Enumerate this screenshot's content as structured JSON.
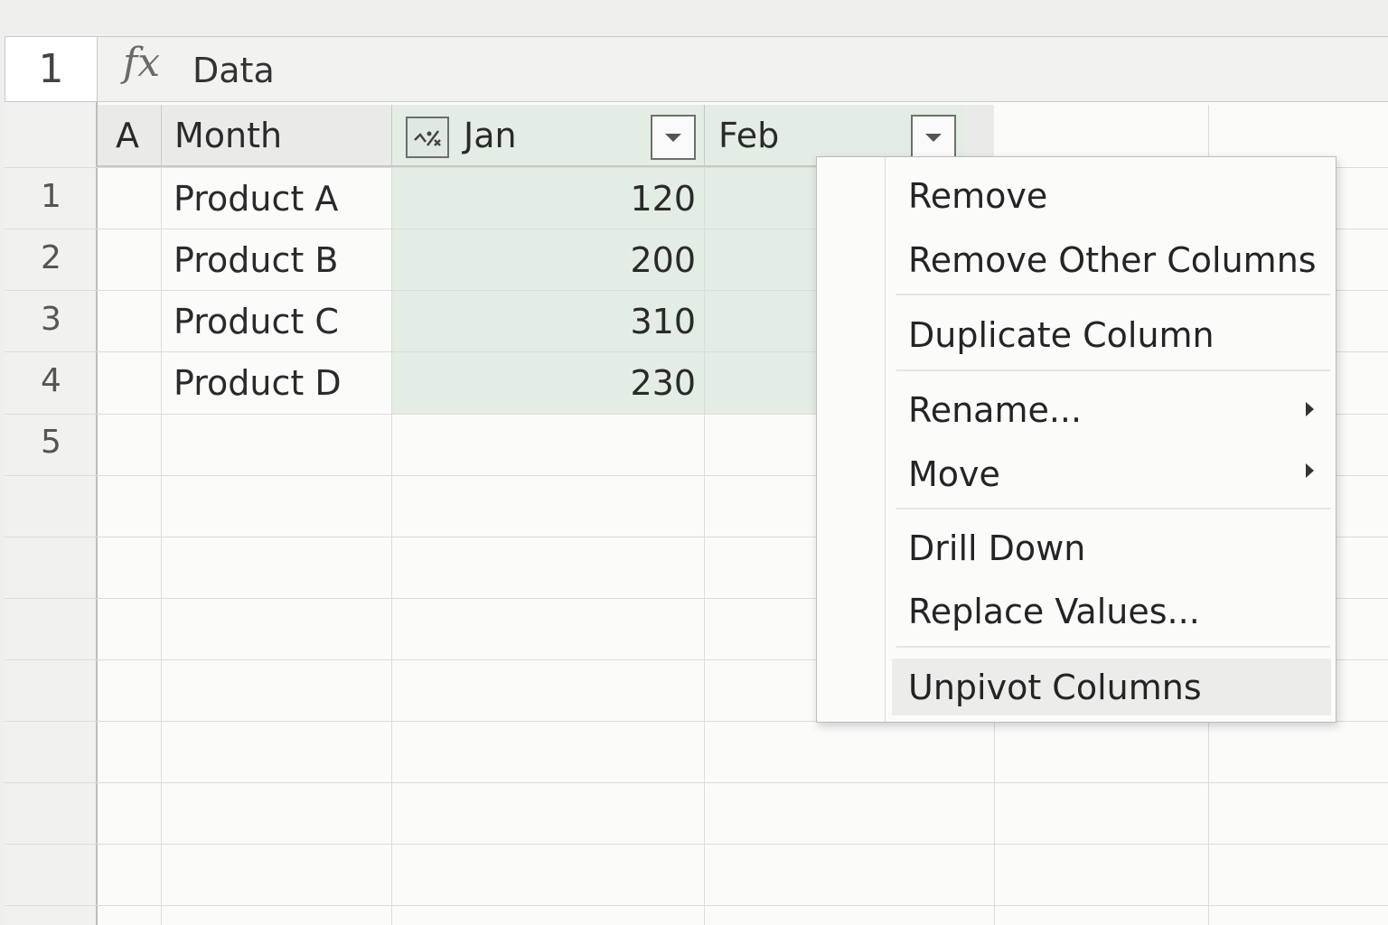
{
  "formula_bar": {
    "name_box": "1",
    "fx": "fx",
    "formula": "Data"
  },
  "grid": {
    "column_letter": "A",
    "columns": [
      {
        "label": "Month"
      },
      {
        "label": "Jan",
        "type_icon": "number-type-icon"
      },
      {
        "label": "Feb"
      }
    ],
    "row_numbers": [
      "1",
      "2",
      "3",
      "4",
      "5"
    ],
    "rows": [
      {
        "month": "Product A",
        "jan": "120"
      },
      {
        "month": "Product B",
        "jan": "200"
      },
      {
        "month": "Product C",
        "jan": "310"
      },
      {
        "month": "Product D",
        "jan": "230"
      }
    ]
  },
  "context_menu": {
    "items": [
      {
        "label": "Remove"
      },
      {
        "label": "Remove Other Columns"
      },
      {
        "label": "Duplicate Column"
      },
      {
        "label": "Rename..."
      },
      {
        "label": "Move"
      },
      {
        "label": "Drill Down"
      },
      {
        "label": "Replace Values..."
      },
      {
        "label": "Unpivot Columns",
        "highlighted": true
      }
    ]
  },
  "colors": {
    "selected_column": "#e3ede4",
    "menu_highlight": "#ececea"
  }
}
